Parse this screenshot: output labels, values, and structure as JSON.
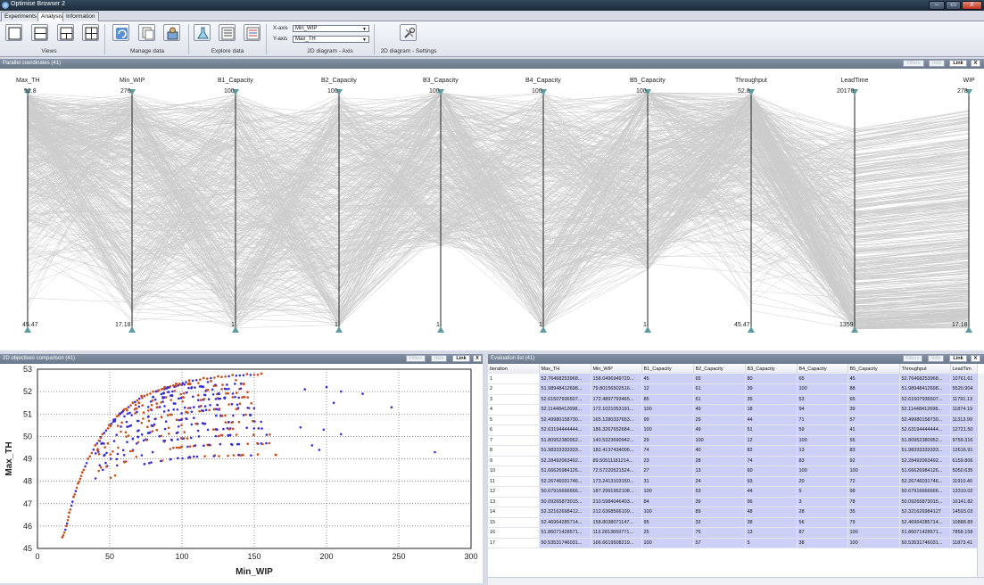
{
  "window": {
    "title": "Optimise Browser 2",
    "minimize": "–",
    "maximize": "▭",
    "close": "X"
  },
  "tabs": [
    {
      "label": "Experiments"
    },
    {
      "label": "Analysis",
      "active": true
    },
    {
      "label": "Information"
    }
  ],
  "ribbon": {
    "groups": {
      "views": "Views",
      "manage": "Manage data",
      "explore": "Explore data",
      "axis": "2D diagram - Axis",
      "settings": "2D diagram - Settings"
    },
    "xaxis_label": "X-axis",
    "xaxis_value": "Min_WIP",
    "yaxis_label": "Y-axis",
    "yaxis_value": "Max_TH",
    "icons": [
      "layout-1-icon",
      "layout-2h-icon",
      "layout-3-icon",
      "layout-4-icon",
      "refresh-icon",
      "copy-icon",
      "import-icon",
      "flask-icon",
      "list-icon",
      "list-color-icon",
      "tools-icon"
    ]
  },
  "parallel": {
    "title": "Parallel coordinates (41)",
    "buttons": {
      "filters": "Filters",
      "hide": "Hide",
      "link": "Link",
      "close": "X"
    },
    "axes": [
      {
        "name": "Max_TH",
        "top": "52.8",
        "bottom": "45.47"
      },
      {
        "name": "Min_WIP",
        "top": "276",
        "bottom": "17.18"
      },
      {
        "name": "B1_Capacity",
        "top": "100",
        "bottom": "1"
      },
      {
        "name": "B2_Capacity",
        "top": "100",
        "bottom": "1"
      },
      {
        "name": "B3_Capacity",
        "top": "100",
        "bottom": "1"
      },
      {
        "name": "B4_Capacity",
        "top": "100",
        "bottom": "1"
      },
      {
        "name": "B5_Capacity",
        "top": "100",
        "bottom": "1"
      },
      {
        "name": "Throughput",
        "top": "52.8",
        "bottom": "45.47"
      },
      {
        "name": "LeadTime",
        "top": "20170",
        "bottom": "1359"
      },
      {
        "name": "WIP",
        "top": "278",
        "bottom": "17.18"
      }
    ]
  },
  "scatter": {
    "title": "2D objectives comparison (41)",
    "buttons": {
      "filters": "Filters",
      "hide": "Hide",
      "link": "Link",
      "close": "X"
    }
  },
  "eval": {
    "title": "Evaluation list (41)",
    "buttons": {
      "filters": "Filters",
      "hide": "Hide",
      "link": "Link",
      "close": "X"
    },
    "columns": [
      "Iteration",
      "Max_TH",
      "Min_WIP",
      "B1_Capacity",
      "B2_Capacity",
      "B3_Capacity",
      "B4_Capacity",
      "B5_Capacity",
      "Throughput",
      "LeadTim"
    ],
    "rows": [
      [
        "1",
        "52.76468253968...",
        "158.0496949729...",
        "45",
        "65",
        "80",
        "65",
        "45",
        "52.76468253968...",
        "10761.61"
      ],
      [
        "2",
        "51.98948412698...",
        "79.80156502516...",
        "12",
        "61",
        "39",
        "100",
        "88",
        "51.98948412698...",
        "5520.904"
      ],
      [
        "3",
        "52.61507936507...",
        "172.4897793465...",
        "85",
        "61",
        "35",
        "53",
        "65",
        "52.61507936507...",
        "11791.13"
      ],
      [
        "4",
        "52.11448412698...",
        "172.1021053191...",
        "100",
        "49",
        "18",
        "94",
        "39",
        "52.11448412698...",
        "11874.19"
      ],
      [
        "5",
        "52.49980158730...",
        "165.1280337653...",
        "99",
        "29",
        "44",
        "71",
        "57",
        "52.49980158730...",
        "11313.99"
      ],
      [
        "6",
        "52.63194444444...",
        "186.3267652684...",
        "100",
        "49",
        "51",
        "59",
        "41",
        "52.63194444444...",
        "12721.50"
      ],
      [
        "7",
        "51.80952380952...",
        "140.5323690942...",
        "29",
        "100",
        "12",
        "100",
        "55",
        "51.80952380952...",
        "9759.316"
      ],
      [
        "8",
        "51.98333333333...",
        "182.4137434006...",
        "74",
        "40",
        "82",
        "13",
        "83",
        "51.98333333333...",
        "12616.91"
      ],
      [
        "9",
        "52.28492063492...",
        "89.50511181214...",
        "23",
        "28",
        "74",
        "83",
        "92",
        "52.28492063492...",
        "6159.806"
      ],
      [
        "10",
        "51.66626984126...",
        "72.57220521524...",
        "27",
        "13",
        "60",
        "100",
        "100",
        "51.66626984126...",
        "5050.635"
      ],
      [
        "11",
        "52.26746031746...",
        "173.2413103150...",
        "31",
        "24",
        "93",
        "20",
        "72",
        "52.26746031746...",
        "11910.40"
      ],
      [
        "12",
        "50.67916666666...",
        "187.2991952108...",
        "100",
        "53",
        "44",
        "5",
        "98",
        "50.67916666666...",
        "13310.02"
      ],
      [
        "13",
        "50.09265873015...",
        "210.5984046403...",
        "84",
        "39",
        "96",
        "3",
        "78",
        "50.09265873015...",
        "16141.82"
      ],
      [
        "14",
        "52.32162698412...",
        "212.6368566109...",
        "100",
        "89",
        "48",
        "28",
        "35",
        "52.321626984127",
        "14593.03"
      ],
      [
        "15",
        "52.46964285714...",
        "158.8038071147...",
        "95",
        "32",
        "38",
        "56",
        "79",
        "52.46964285714...",
        "10888.89"
      ],
      [
        "16",
        "51.86071428571...",
        "113.2813659771...",
        "25",
        "75",
        "13",
        "87",
        "100",
        "51.86071428571...",
        "7858.158"
      ],
      [
        "17",
        "50.53531746031...",
        "166.6619508219...",
        "100",
        "57",
        "5",
        "38",
        "100",
        "50.53531746031...",
        "11873.41"
      ]
    ]
  },
  "chart_data": {
    "type": "scatter",
    "xlabel": "Min_WIP",
    "ylabel": "Max_TH",
    "xlim": [
      0,
      300
    ],
    "ylim": [
      45,
      53
    ],
    "xticks": [
      "0",
      "50",
      "100",
      "150",
      "200",
      "250",
      "300"
    ],
    "yticks": [
      "45",
      "46",
      "47",
      "48",
      "49",
      "50",
      "51",
      "52",
      "53"
    ],
    "grid": true,
    "colors": {
      "front": "#c8501e",
      "points": "#3a2fd0"
    },
    "front": [
      [
        17.2,
        45.5
      ],
      [
        20,
        46.0
      ],
      [
        22,
        46.6
      ],
      [
        25,
        47.3
      ],
      [
        28,
        47.9
      ],
      [
        31,
        48.4
      ],
      [
        35,
        49.0
      ],
      [
        40,
        49.6
      ],
      [
        45,
        50.1
      ],
      [
        50,
        50.5
      ],
      [
        55,
        50.9
      ],
      [
        60,
        51.2
      ],
      [
        66,
        51.5
      ],
      [
        72,
        51.8
      ],
      [
        80,
        52.0
      ],
      [
        88,
        52.2
      ],
      [
        96,
        52.35
      ],
      [
        105,
        52.5
      ],
      [
        115,
        52.6
      ],
      [
        125,
        52.68
      ],
      [
        135,
        52.74
      ],
      [
        145,
        52.78
      ],
      [
        155,
        52.8
      ]
    ],
    "levels": [
      49.2,
      49.7,
      50.1,
      50.4,
      50.7,
      51.0,
      51.3,
      51.5,
      51.8,
      52.0,
      52.2,
      52.4,
      52.6
    ],
    "outliers": [
      [
        185,
        52.1
      ],
      [
        200,
        52.2
      ],
      [
        210,
        52.0
      ],
      [
        225,
        51.9
      ],
      [
        245,
        51.3
      ],
      [
        275,
        49.3
      ],
      [
        190,
        49.6
      ],
      [
        195,
        49.4
      ],
      [
        205,
        51.5
      ],
      [
        198,
        50.3
      ],
      [
        182,
        50.4
      ],
      [
        210,
        50.1
      ]
    ]
  }
}
